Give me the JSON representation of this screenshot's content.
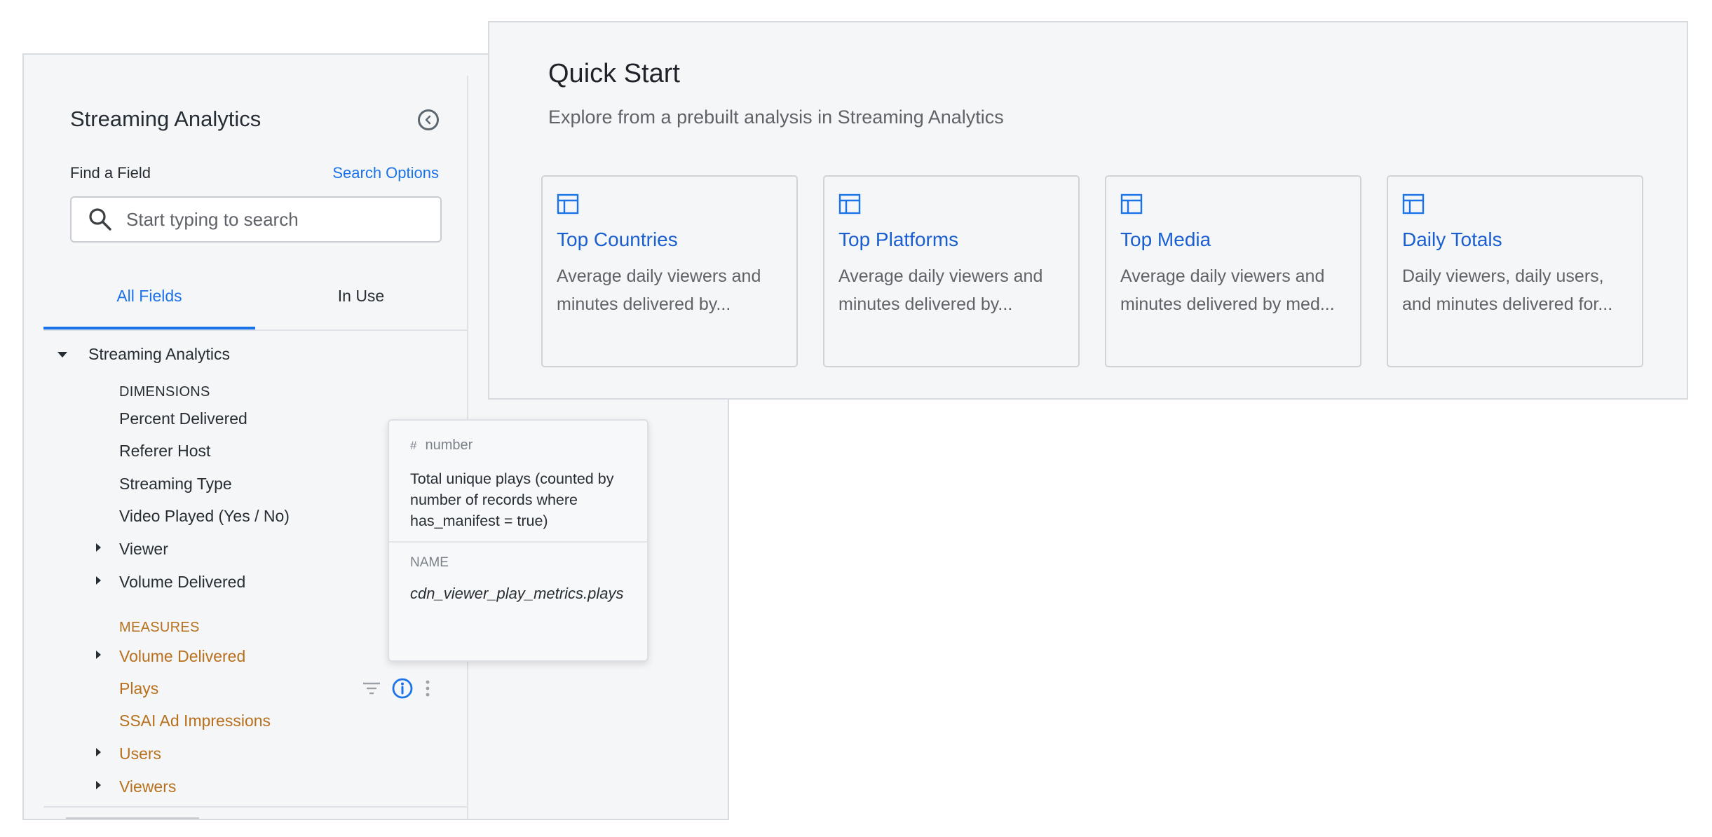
{
  "field_panel": {
    "title": "Streaming Analytics",
    "find_label": "Find a Field",
    "search_options": "Search Options",
    "search_placeholder": "Start typing to search",
    "tabs": [
      {
        "label": "All Fields",
        "active": true
      },
      {
        "label": "In Use",
        "active": false
      }
    ],
    "tree": {
      "group": "Streaming Analytics",
      "dimensions_label": "DIMENSIONS",
      "dimensions": [
        {
          "label": "Percent Delivered",
          "expandable": false
        },
        {
          "label": "Referer Host",
          "expandable": false
        },
        {
          "label": "Streaming Type",
          "expandable": false
        },
        {
          "label": "Video Played (Yes / No)",
          "expandable": false
        },
        {
          "label": "Viewer",
          "expandable": true
        },
        {
          "label": "Volume Delivered",
          "expandable": true
        }
      ],
      "measures_label": "MEASURES",
      "measures": [
        {
          "label": "Volume Delivered",
          "expandable": true
        },
        {
          "label": "Plays",
          "expandable": false
        },
        {
          "label": "SSAI Ad Impressions",
          "expandable": false
        },
        {
          "label": "Users",
          "expandable": true
        },
        {
          "label": "Viewers",
          "expandable": true
        }
      ]
    },
    "icons": {
      "collapse": "chevron-left-circle-icon",
      "search": "search-icon",
      "filter": "filter-icon",
      "info": "info-icon",
      "more": "more-vertical-icon"
    }
  },
  "tooltip": {
    "type_symbol": "#",
    "type": "number",
    "description": "Total unique plays (counted by number of records where has_manifest = true)",
    "name_label": "NAME",
    "name": "cdn_viewer_play_metrics.plays"
  },
  "quick_start": {
    "title": "Quick Start",
    "subtitle": "Explore from a prebuilt analysis in Streaming Analytics",
    "cards": [
      {
        "title": "Top Countries",
        "desc_line1": "Average daily viewers and",
        "desc_line2": "minutes delivered by..."
      },
      {
        "title": "Top Platforms",
        "desc_line1": "Average daily viewers and",
        "desc_line2": "minutes delivered by..."
      },
      {
        "title": "Top Media",
        "desc_line1": "Average daily viewers and",
        "desc_line2": "minutes delivered by med..."
      },
      {
        "title": "Daily Totals",
        "desc_line1": "Daily viewers, daily users,",
        "desc_line2": "and minutes delivered for..."
      }
    ],
    "card_icon": "table-icon"
  },
  "colors": {
    "accent": "#1a73e8",
    "measure": "#b8701d",
    "panel_bg": "#f5f6f8"
  }
}
